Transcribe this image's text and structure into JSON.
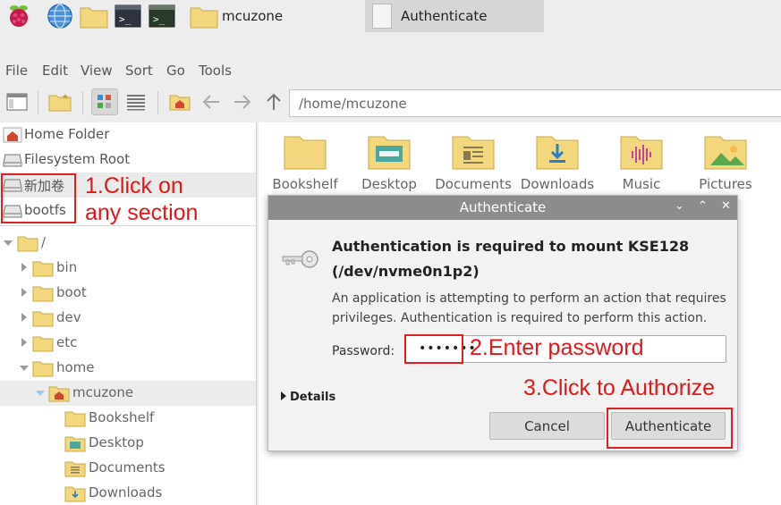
{
  "taskbar": {
    "folder_label": "mcuzone",
    "active_window_label": "Authenticate"
  },
  "menu": [
    "File",
    "Edit",
    "View",
    "Sort",
    "Go",
    "Tools"
  ],
  "address": {
    "path": "/home/mcuzone"
  },
  "places": [
    {
      "label": "Home Folder",
      "icon": "home-folder-icon"
    },
    {
      "label": "Filesystem Root",
      "icon": "drive-icon"
    },
    {
      "label": "新加卷",
      "icon": "drive-icon"
    },
    {
      "label": "bootfs",
      "icon": "drive-icon"
    }
  ],
  "tree": {
    "root": "/",
    "children": [
      "bin",
      "boot",
      "dev",
      "etc",
      "home"
    ],
    "home_child": "mcuzone",
    "mcuzone_children": [
      "Bookshelf",
      "Desktop",
      "Documents",
      "Downloads"
    ]
  },
  "files": [
    "Bookshelf",
    "Desktop",
    "Documents",
    "Downloads",
    "Music",
    "Pictures"
  ],
  "dialog": {
    "title": "Authenticate",
    "heading": "Authentication is required to mount KSE128 (/dev/nvme0n1p2)",
    "description": "An application is attempting to perform an action that requires privileges. Authentication is required to perform this action.",
    "password_label": "Password:",
    "password_value": "•••••••",
    "details_label": "Details",
    "cancel_label": "Cancel",
    "authenticate_label": "Authenticate",
    "title_buttons": [
      "⌄",
      "⌃",
      "✕"
    ]
  },
  "annotations": {
    "step1_line1": "1.Click on",
    "step1_line2": "any section",
    "step2": "2.Enter password",
    "step3": "3.Click to Authorize"
  },
  "colors": {
    "annotation_red": "#e02020",
    "folder_yellow": "#f3d77e",
    "titlebar_gray": "#8c8c8c"
  }
}
